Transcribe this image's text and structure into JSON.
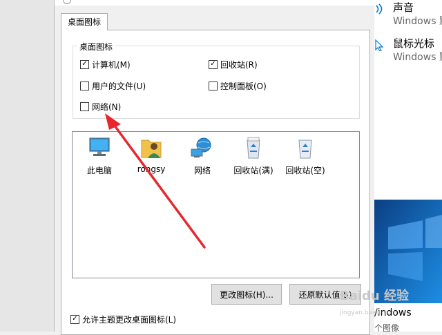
{
  "dialog": {
    "tab_label": "桌面图标",
    "group_legend": "桌面图标",
    "checkboxes": [
      {
        "label": "计算机(M)",
        "checked": true
      },
      {
        "label": "回收站(R)",
        "checked": true
      },
      {
        "label": "用户的文件(U)",
        "checked": false
      },
      {
        "label": "控制面板(O)",
        "checked": false
      },
      {
        "label": "网络(N)",
        "checked": false
      }
    ],
    "icons": [
      {
        "label": "此电脑",
        "icon": "computer-icon"
      },
      {
        "label": "rongsy",
        "icon": "user-folder-icon"
      },
      {
        "label": "网络",
        "icon": "network-icon"
      },
      {
        "label": "回收站(满)",
        "icon": "recycle-bin-full-icon"
      },
      {
        "label": "回收站(空)",
        "icon": "recycle-bin-empty-icon"
      }
    ],
    "change_icon_button": "更改图标(H)...",
    "restore_default_button": "还原默认值(S)",
    "allow_theme_checkbox": {
      "label": "允许主题更改桌面图标(L)",
      "checked": true
    }
  },
  "right_panel": {
    "sound": {
      "title": "声音",
      "subtitle": "Windows 默"
    },
    "mouse_pointer": {
      "title": "鼠标光标",
      "subtitle": "Windows 默"
    },
    "wallpaper_caption": "/indows",
    "wallpaper_sub": "个图像"
  },
  "watermark": {
    "text": "Baidu 经验",
    "sub": "jingyan.baidu.com"
  },
  "colors": {
    "arrow": "#e8262d",
    "wallpaper": "#1565b0",
    "window_accent": "#0078d7"
  }
}
